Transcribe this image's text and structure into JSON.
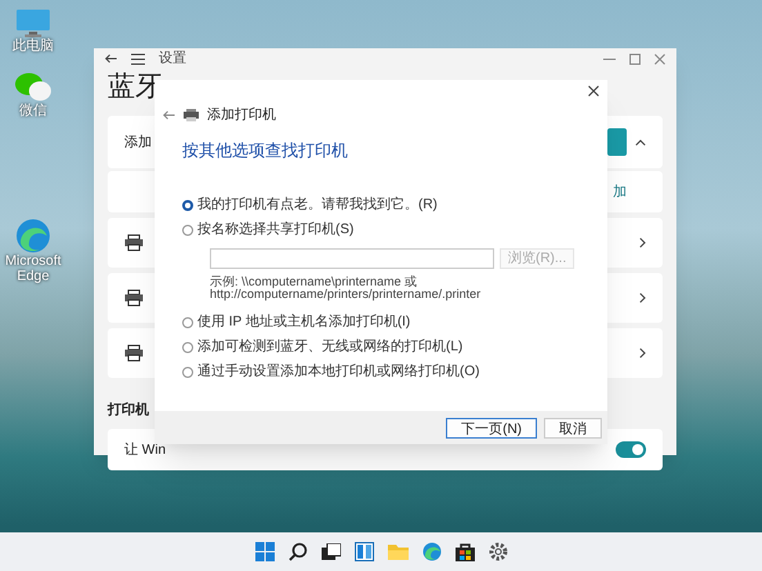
{
  "desktop_icons": [
    {
      "label": "此电脑",
      "kind": "monitor"
    },
    {
      "label": "微信",
      "kind": "chat"
    },
    {
      "label": "Microsoft Edge",
      "kind": "edge"
    }
  ],
  "settings_window": {
    "title": "设置",
    "heading": "蓝牙",
    "cards": [
      {
        "kind": "expander",
        "label": "添加",
        "expanded": true
      },
      {
        "kind": "add",
        "action": "加"
      },
      {
        "kind": "device"
      },
      {
        "kind": "device"
      },
      {
        "kind": "device"
      }
    ],
    "section_heading": "打印机",
    "toggle_row": {
      "label": "让 Win",
      "on": true
    }
  },
  "dialog": {
    "title": "添加打印机",
    "heading": "按其他选项查找打印机",
    "options": [
      {
        "kind": "plain",
        "label": "我的打印机有点老。请帮我找到它。(R)",
        "selected": true
      },
      {
        "kind": "share",
        "label": "按名称选择共享打印机(S)",
        "selected": false,
        "browse_button": {
          "label": "浏览(R)...",
          "disabled": true
        },
        "example": [
          "示例: \\\\computername\\printername 或",
          "http://computername/printers/printername/.printer"
        ]
      },
      {
        "kind": "plain",
        "label": "使用 IP 地址或主机名添加打印机(I)",
        "selected": false
      },
      {
        "kind": "plain",
        "label": "添加可检测到蓝牙、无线或网络的打印机(L)",
        "selected": false
      },
      {
        "kind": "plain",
        "label": "通过手动设置添加本地打印机或网络打印机(O)",
        "selected": false
      }
    ],
    "buttons": [
      {
        "label": "下一页(N)",
        "default": true
      },
      {
        "label": "取消",
        "default": false
      }
    ]
  }
}
